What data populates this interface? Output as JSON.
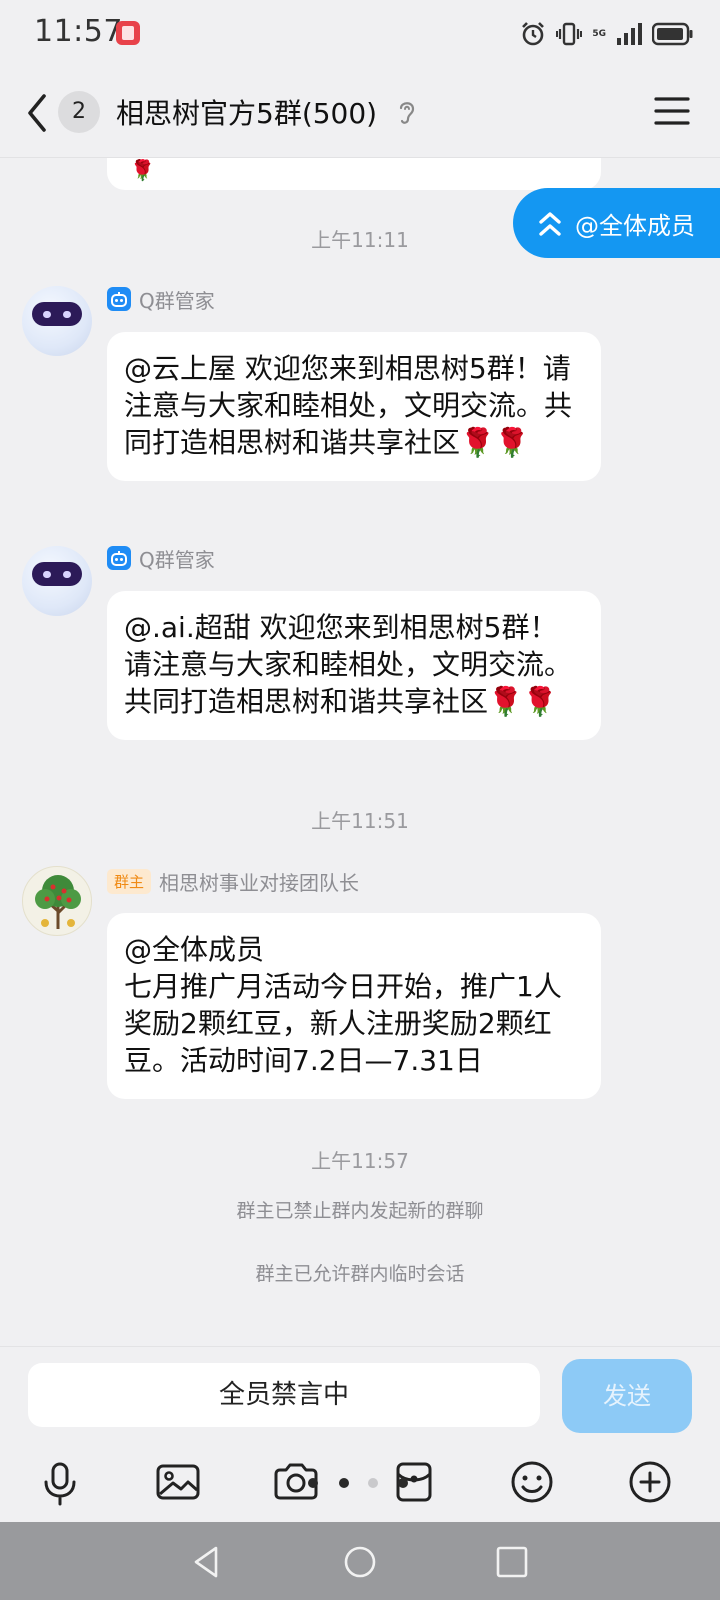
{
  "status_bar": {
    "time": "11:57",
    "network": "5G",
    "icons": [
      "notification-icon",
      "alarm-icon",
      "vibrate-icon",
      "signal-icon",
      "battery-icon"
    ]
  },
  "header": {
    "unread_count": "2",
    "title": "相思树官方5群(500)",
    "icons": [
      "back-arrow-icon",
      "ear-icon",
      "menu-icon"
    ]
  },
  "at_all_pill": {
    "label": "@全体成员",
    "icon": "double-chevron-up-icon"
  },
  "messages": [
    {
      "type": "time",
      "text": "上午11:11"
    },
    {
      "type": "message",
      "sender": "Q群管家",
      "avatar": "robot-avatar",
      "text": "@云上屋 欢迎您来到相思树5群！请注意与大家和睦相处，文明交流。共同打造相思树和谐共享社区🌹🌹"
    },
    {
      "type": "message",
      "sender": "Q群管家",
      "avatar": "robot-avatar",
      "text": "@.ai.超甜 欢迎您来到相思树5群！请注意与大家和睦相处，文明交流。共同打造相思树和谐共享社区🌹🌹"
    },
    {
      "type": "time",
      "text": "上午11:51"
    },
    {
      "type": "message",
      "sender": "相思树事业对接团队长",
      "role": "群主",
      "avatar": "tree-avatar",
      "text": "@全体成员\n七月推广月活动今日开始，推广1人奖励2颗红豆，新人注册奖励2颗红豆。活动时间7.2日—7.31日"
    },
    {
      "type": "time",
      "text": "上午11:57"
    },
    {
      "type": "system",
      "text": "群主已禁止群内发起新的群聊"
    },
    {
      "type": "system",
      "text": "群主已允许群内临时会话"
    }
  ],
  "input": {
    "text": "全员禁言中",
    "send_label": "发送"
  },
  "toolbar": {
    "tools": [
      "microphone-icon",
      "image-icon",
      "camera-icon",
      "red-packet-icon",
      "emoji-icon",
      "plus-icon"
    ],
    "page_dots": {
      "count": 3,
      "active": 0
    }
  },
  "nav_bar": {
    "buttons": [
      "nav-back-icon",
      "nav-home-icon",
      "nav-recents-icon"
    ]
  },
  "colors": {
    "background": "#f0f0f2",
    "accent": "#1497f2",
    "send_disabled": "#8dcaf6",
    "owner_badge": "#f08a14",
    "bubble": "#ffffff",
    "meta_text": "#9a9a9e"
  }
}
